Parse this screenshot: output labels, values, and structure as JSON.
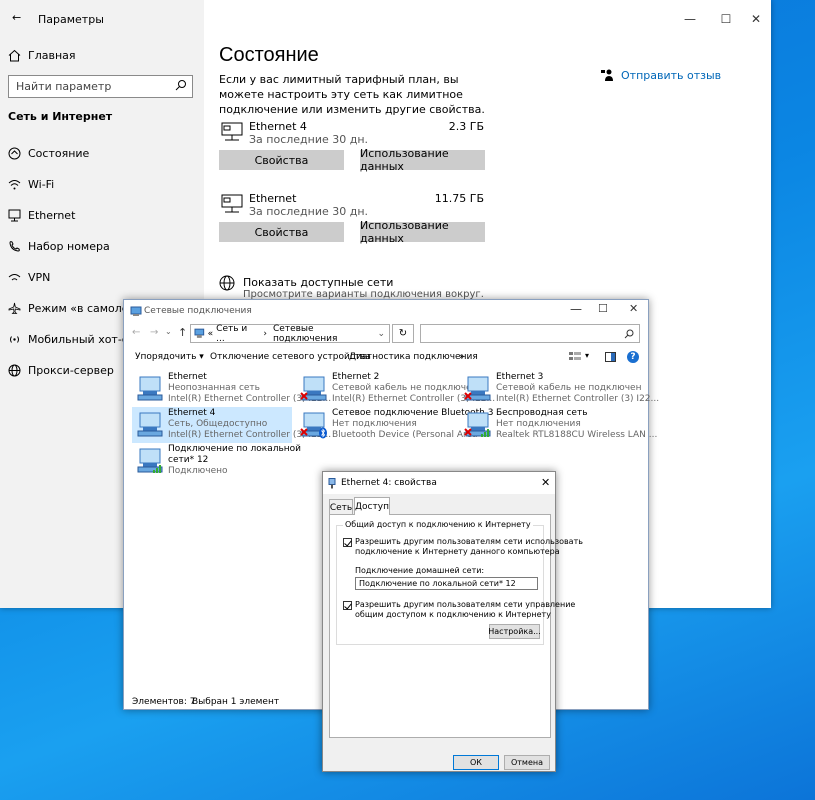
{
  "settings": {
    "title": "Параметры",
    "home": "Главная",
    "search_placeholder": "Найти параметр",
    "section": "Сеть и Интернет",
    "nav": [
      {
        "label": "Состояние",
        "icon": "home-status-icon"
      },
      {
        "label": "Wi-Fi",
        "icon": "wifi-icon"
      },
      {
        "label": "Ethernet",
        "icon": "ethernet-icon"
      },
      {
        "label": "Набор номера",
        "icon": "dialup-icon"
      },
      {
        "label": "VPN",
        "icon": "vpn-icon"
      },
      {
        "label": "Режим «в самолете»",
        "icon": "airplane-icon"
      },
      {
        "label": "Мобильный хот-спот",
        "icon": "hotspot-icon"
      },
      {
        "label": "Прокси-сервер",
        "icon": "globe-icon"
      }
    ],
    "page_title": "Состояние",
    "description": "Если у вас лимитный тарифный план, вы можете настроить эту сеть как лимитное подключение или изменить другие свойства.",
    "feedback": "Отправить отзыв",
    "networks": [
      {
        "name": "Ethernet 4",
        "sub": "За последние 30 дн.",
        "size": "2.3 ГБ",
        "btn_props": "Свойства",
        "btn_usage": "Использование данных"
      },
      {
        "name": "Ethernet",
        "sub": "За последние 30 дн.",
        "size": "11.75 ГБ",
        "btn_props": "Свойства",
        "btn_usage": "Использование данных"
      }
    ],
    "show_networks": {
      "title": "Показать доступные сети",
      "sub": "Просмотрите варианты подключения вокруг."
    }
  },
  "explorer": {
    "title": "Сетевые подключения",
    "path_prefix": "«",
    "path_part1": "Сеть и ...",
    "path_sep": "›",
    "path_part2": "Сетевые подключения",
    "commands": [
      "Упорядочить ▾",
      "Отключение сетевого устройства",
      "Диагностика подключения",
      "»"
    ],
    "connections": [
      {
        "name": "Ethernet",
        "status": "Неопознанная сеть",
        "device": "Intel(R) Ethernet Controller (3) I22..."
      },
      {
        "name": "Ethernet 2",
        "status": "Сетевой кабель не подключен",
        "device": "Intel(R) Ethernet Controller (3) I22..."
      },
      {
        "name": "Ethernet 3",
        "status": "Сетевой кабель не подключен",
        "device": "Intel(R) Ethernet Controller (3) I22..."
      },
      {
        "name": "Ethernet 4",
        "status": "Сеть, Общедоступно",
        "device": "Intel(R) Ethernet Controller (3) I22..."
      },
      {
        "name": "Сетевое подключение Bluetooth 3",
        "status": "Нет подключения",
        "device": "Bluetooth Device (Personal Area ..."
      },
      {
        "name": "Беспроводная сеть",
        "status": "Нет подключения",
        "device": "Realtek RTL8188CU Wireless LAN ..."
      },
      {
        "name": "Подключение по локальной",
        "name2": "сети* 12",
        "status": "Подключено"
      }
    ],
    "status_count": "Элементов: 7",
    "status_selected": "Выбран 1 элемент"
  },
  "props": {
    "title": "Ethernet 4: свойства",
    "tabs": [
      "Сеть",
      "Доступ"
    ],
    "group_title": "Общий доступ к подключению к Интернету",
    "allow_line1": "Разрешить другим пользователям сети использовать",
    "allow_line2": "подключение к Интернету данного компьютера",
    "home_label": "Подключение домашней сети:",
    "home_value": "Подключение по локальной сети* 12",
    "allow2_line1": "Разрешить другим пользователям сети управление",
    "allow2_line2": "общим доступом к подключению к Интернету",
    "settings_btn": "Настройка...",
    "ok": "ОК",
    "cancel": "Отмена"
  }
}
